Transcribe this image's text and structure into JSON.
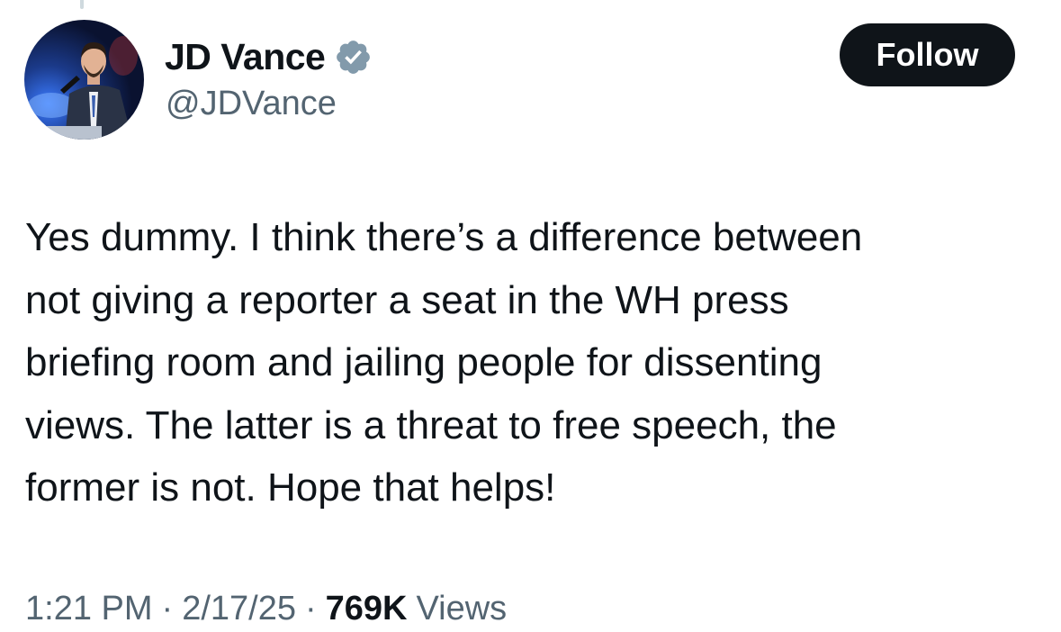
{
  "author": {
    "display_name": "JD Vance",
    "handle": "@JDVance",
    "verified_icon": "verified-badge-icon",
    "avatar": "profile-photo"
  },
  "actions": {
    "follow_label": "Follow"
  },
  "tweet": {
    "lines": [
      "Yes dummy. I think there’s a difference between",
      "not giving a reporter a seat in the WH press",
      "briefing room and jailing people for dissenting",
      "views. The latter is a threat to free speech, the",
      "former is not. Hope that helps!"
    ]
  },
  "meta": {
    "time": "1:21 PM",
    "separator": "·",
    "date": "2/17/25",
    "views_count": "769K",
    "views_label": "Views"
  },
  "colors": {
    "text_primary": "#0f1419",
    "text_secondary": "#536471",
    "verified": "#829aab",
    "follow_bg": "#0f1419",
    "follow_text": "#ffffff"
  }
}
